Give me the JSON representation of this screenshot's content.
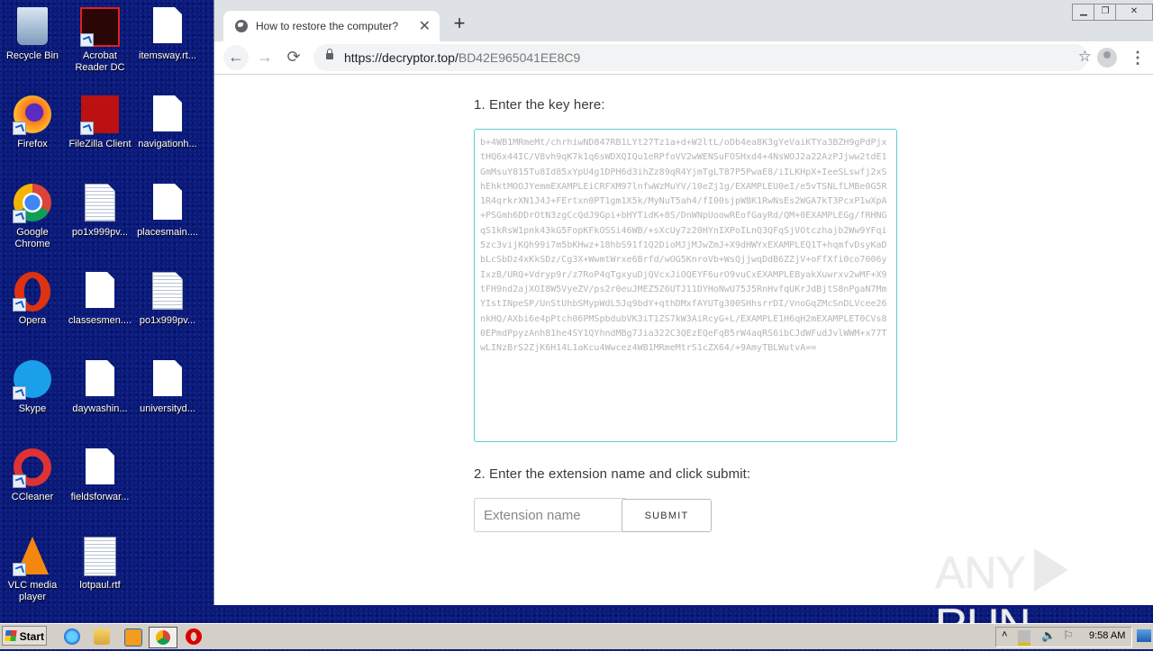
{
  "desktop": {
    "icons": [
      {
        "label": "Recycle Bin",
        "icon": "recycle-bin-icon"
      },
      {
        "label": "Acrobat Reader DC",
        "icon": "acrobat-reader-icon"
      },
      {
        "label": "itemsway.rt...",
        "icon": "file-icon"
      },
      {
        "label": "Firefox",
        "icon": "firefox-icon"
      },
      {
        "label": "FileZilla Client",
        "icon": "filezilla-icon"
      },
      {
        "label": "navigationh...",
        "icon": "file-icon"
      },
      {
        "label": "Google Chrome",
        "icon": "chrome-icon"
      },
      {
        "label": "po1x999pv...",
        "icon": "text-file-icon"
      },
      {
        "label": "placesmain....",
        "icon": "file-icon"
      },
      {
        "label": "Opera",
        "icon": "opera-icon"
      },
      {
        "label": "classesmen....",
        "icon": "file-icon"
      },
      {
        "label": "po1x999pv...",
        "icon": "text-file-icon"
      },
      {
        "label": "Skype",
        "icon": "skype-icon"
      },
      {
        "label": "daywashin...",
        "icon": "file-icon"
      },
      {
        "label": "universityd...",
        "icon": "file-icon"
      },
      {
        "label": "CCleaner",
        "icon": "ccleaner-icon"
      },
      {
        "label": "fieldsforwar...",
        "icon": "file-icon"
      },
      {
        "label": "VLC media player",
        "icon": "vlc-icon"
      },
      {
        "label": "lotpaul.rtf",
        "icon": "word-doc-icon"
      }
    ]
  },
  "browser": {
    "tab_title": "How to restore the computer?",
    "tab_close": "✕",
    "new_tab": "+",
    "url_host": "https://decryptor.top/",
    "url_path": "BD42E965041EE8C9",
    "back": "←",
    "forward": "→",
    "reload": "⟳",
    "star": "☆",
    "menu": "⋮",
    "window_controls": {
      "minimize": "▁",
      "restore": "❐",
      "close": "✕"
    }
  },
  "page": {
    "step1_label": "1. Enter the key here:",
    "key_text": "b+4WB1MRmeMt/chrhiwND847RB1LYt27Tz1a+d+W2ltL/oDb4ea8K3gYeVaiKTYa3BZH9gPdPjxtHQ6x44IC/V8vh9qK7k1q6sWDXQIQu1eRPfoVV2wWENSuFOSHxd4+4NsWOJ2a22AzPJjww2tdE1GmMsuY815Tu8Id85xYpU4g1DPH6d3ihZz89qR4YjmTgLT87P5PwaE8/iILKHpX+IeeSLswfj2xShEhktMOOJYemmEXAMPLEiCRFXM97lnfwWzMuYV/10eZj1g/EXAMPLEU0eI/e5vTSNLfLMBe0G5R1R4qrkrXN1J4J+FErtxn0PT1gm1X5k/MyNuT5ah4/fI00sjpW8K1RwNsEs2WGA7kT3PcxP1wXpA+PSGmh6DDrOtN3zgCcQdJ9Gpi+bHYTidK+8S/DnWNpUoowREofGayRd/QM+0EXAMPLEGg/fRHNGqS1kRsW1pnk43kG5FopKFkOSSi46WB/+sXcUy7z20HYnIXPoILnQ3QFqSjVOtczhajb2Ww9YFqi5zc3vijKQh99i7m5bKHwz+18hbS91f1Q2DioMJjMJwZmJ+X9dHWYxEXAMPLEQ1T+hqmfvDsyKaDbLcSbDz4xKkSDz/Cg3X+WwmtWrxe6Brfd/wOG5KnroVb+WsQjjwqDdB6ZZjV+oFfXfi0co7006yIxzB/URQ+Vdryp9r/z7RoP4qTgxyuDjQVcxJiOQEYF6urO9vuCxEXAMPLEByakXuwrxv2wMF+X9tFH9nd2ajXOI8W5VyeZV/ps2r0euJMEZ5Z6UTJ11DYHoNwU75J5RnHvfqUKrJdBjtS8nPgaN7MmYIstINpeSP/UnStUhbSMypWdL5Jq9bdY+qthDMxfAYUTg300SHhsrrDI/VnoGqZMcSnDLVcee26nkHQ/AXbi6e4pPtch06PMSpbdubVK3iT1ZS7kW3AiRcyG+L/EXAMPLE1H6qH2mEXAMPLET0CVs80EPmdPpyzAnh81he4SY1QYhndMBg7Jia322C3QEzEQeFqB5rW4aqRS6ibCJdWFudJvlWWM+x77TwLINzBrS2ZjK6H14L1aKcu4Wwcez4WB1MRmeMtrS1cZX64/+9AmyTBLWutvA==",
    "step2_label": "2. Enter the extension name and click submit:",
    "extension_placeholder": "Extension name",
    "extension_value": "",
    "submit_label": "SUBMIT"
  },
  "watermark": {
    "left": "ANY",
    "right": "RUN"
  },
  "taskbar": {
    "start_label": "Start",
    "pinned": [
      "internet-explorer-icon",
      "explorer-icon",
      "media-player-icon",
      "chrome-icon",
      "opera-icon"
    ],
    "clock": "9:58 AM"
  }
}
